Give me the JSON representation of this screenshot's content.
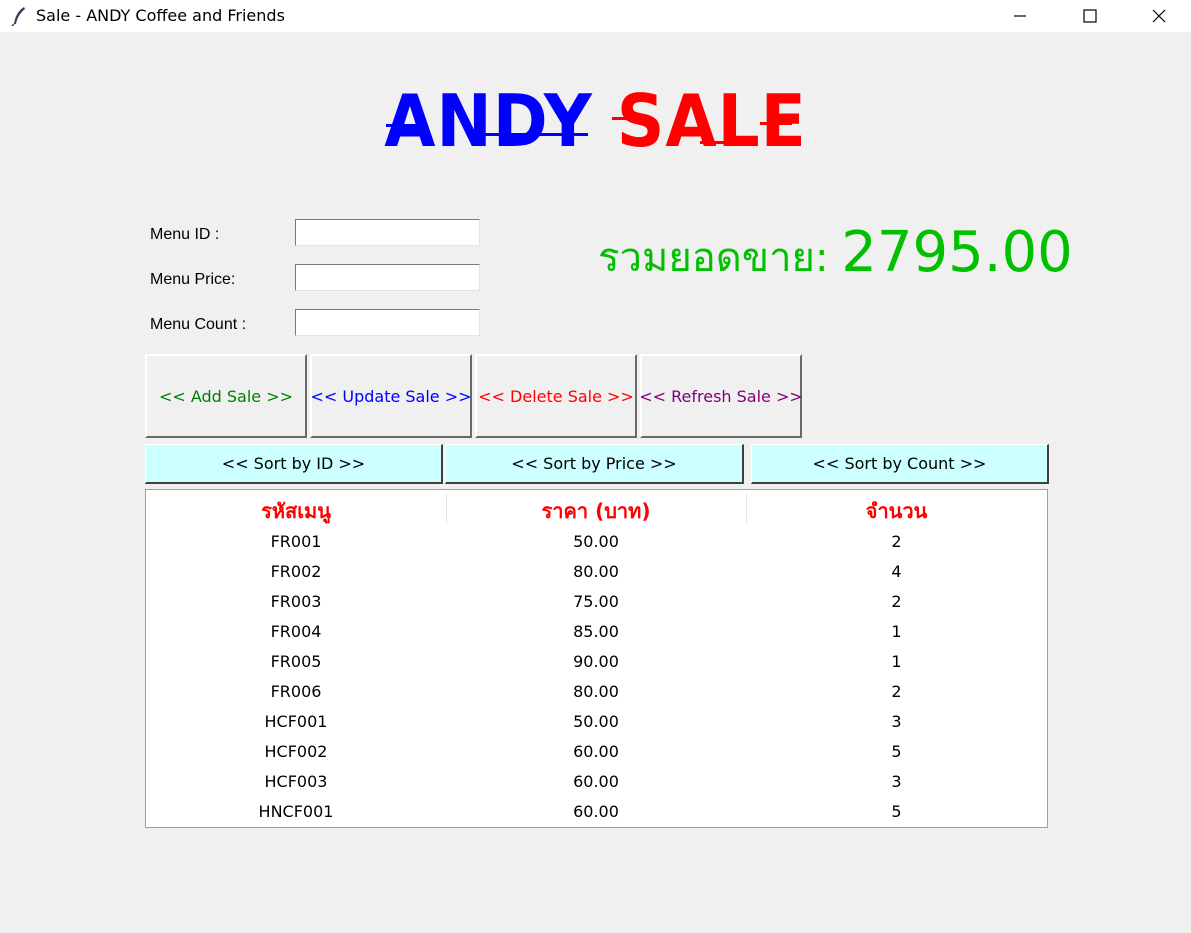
{
  "window": {
    "title": "Sale - ANDY Coffee and Friends"
  },
  "logo": {
    "part1": "ANDY",
    "part2": "SALE",
    "part1_color": "#0000ff",
    "part2_color": "#ff0000"
  },
  "form": {
    "menu_id_label": "Menu ID :",
    "menu_price_label": "Menu Price:",
    "menu_count_label": "Menu Count :",
    "menu_id_value": "",
    "menu_price_value": "",
    "menu_count_value": ""
  },
  "total": {
    "label": "รวมยอดขาย: ",
    "value": "2795.00",
    "color": "#00c000"
  },
  "buttons": {
    "add": {
      "label": "<< Add Sale >>",
      "color": "#008000"
    },
    "update": {
      "label": "<< Update Sale >>",
      "color": "#0000ff"
    },
    "delete": {
      "label": "<< Delete Sale >>",
      "color": "#ff0000"
    },
    "refresh": {
      "label": "<< Refresh Sale >>",
      "color": "#800080"
    }
  },
  "sort": {
    "by_id": "<< Sort by ID >>",
    "by_price": "<< Sort by Price >>",
    "by_count": "<< Sort by Count >>"
  },
  "table": {
    "headers": [
      "รหัสเมนู",
      "ราคา (บาท)",
      "จำนวน"
    ],
    "rows": [
      [
        "FR001",
        "50.00",
        "2"
      ],
      [
        "FR002",
        "80.00",
        "4"
      ],
      [
        "FR003",
        "75.00",
        "2"
      ],
      [
        "FR004",
        "85.00",
        "1"
      ],
      [
        "FR005",
        "90.00",
        "1"
      ],
      [
        "FR006",
        "80.00",
        "2"
      ],
      [
        "HCF001",
        "50.00",
        "3"
      ],
      [
        "HCF002",
        "60.00",
        "5"
      ],
      [
        "HCF003",
        "60.00",
        "3"
      ],
      [
        "HNCF001",
        "60.00",
        "5"
      ]
    ]
  }
}
